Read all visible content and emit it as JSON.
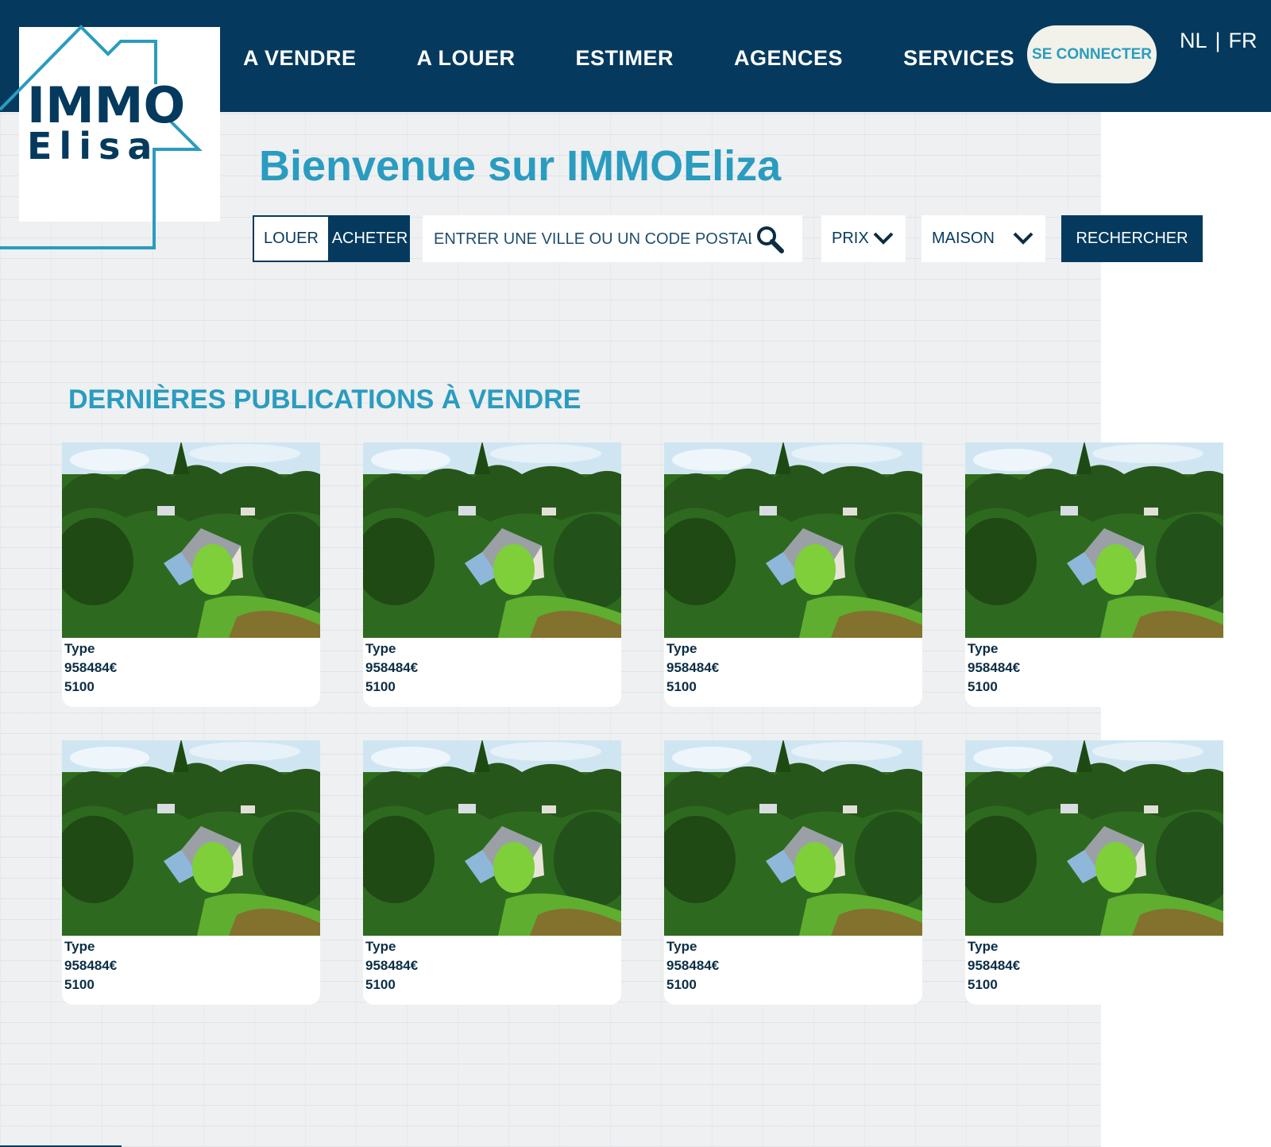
{
  "header": {
    "nav": [
      {
        "id": "a-vendre",
        "label": "A VENDRE"
      },
      {
        "id": "a-louer",
        "label": "A LOUER"
      },
      {
        "id": "estimer",
        "label": "ESTIMER"
      },
      {
        "id": "agences",
        "label": "AGENCES"
      },
      {
        "id": "services",
        "label": "SERVICES"
      }
    ],
    "login_label": "SE CONNECTER",
    "lang_nl": "NL",
    "lang_sep": "|",
    "lang_fr": "FR"
  },
  "logo": {
    "line1": "IMMO",
    "line2": "Elisa"
  },
  "hero": {
    "title": "Bienvenue sur IMMOEliza"
  },
  "search": {
    "mode_rent": "LOUER",
    "mode_buy": "ACHETER",
    "selected_mode": "LOUER",
    "city_placeholder": "ENTRER UNE VILLE OU UN CODE POSTAL",
    "price_select": "PRIX",
    "type_select": "MAISON",
    "submit_label": "RECHERCHER"
  },
  "listings": {
    "title": "DERNIÈRES PUBLICATIONS À VENDRE",
    "items": [
      {
        "type": "Type",
        "price": "958484€",
        "postal": "5100"
      },
      {
        "type": "Type",
        "price": "958484€",
        "postal": "5100"
      },
      {
        "type": "Type",
        "price": "958484€",
        "postal": "5100"
      },
      {
        "type": "Type",
        "price": "958484€",
        "postal": "5100"
      },
      {
        "type": "Type",
        "price": "958484€",
        "postal": "5100"
      },
      {
        "type": "Type",
        "price": "958484€",
        "postal": "5100"
      },
      {
        "type": "Type",
        "price": "958484€",
        "postal": "5100"
      },
      {
        "type": "Type",
        "price": "958484€",
        "postal": "5100"
      }
    ]
  },
  "colors": {
    "navy": "#053a5e",
    "accent": "#2a9cbf",
    "cream": "#f2f2ea"
  },
  "icons": {
    "search": "search-icon",
    "chevron": "chevron-down-icon"
  }
}
